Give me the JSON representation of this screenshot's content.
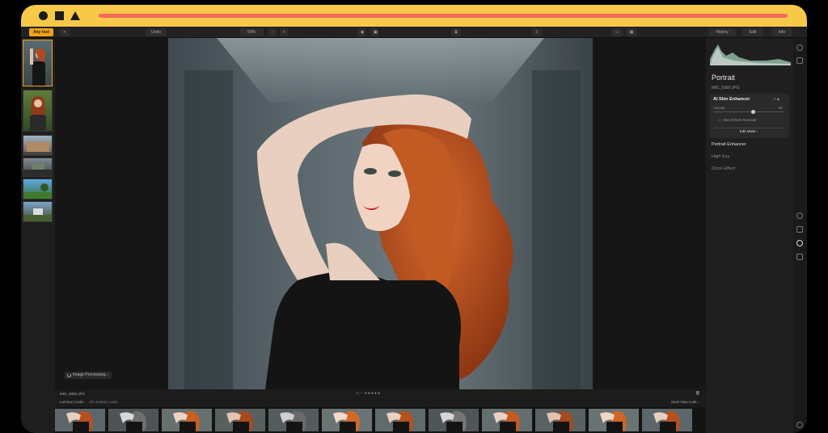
{
  "toolbar": {
    "active_button": "Any tool",
    "undo_label": "Undo",
    "zoom_label": "50%",
    "minus_label": "–",
    "plus_label": "+",
    "history_label": "History",
    "edit_label": "Edit",
    "info_label": "Info"
  },
  "right_panel": {
    "title": "Portrait",
    "filename": "IMG_5990.JPG",
    "card_title": "AI Skin Enhancer",
    "amount_label": "Amount",
    "amount_value": "50",
    "defects_label": "Skin Defects Removal",
    "edit_mask_label": "Edit Mask ›",
    "items": [
      "Portrait Enhancer",
      "High Key",
      "Orton Effect"
    ]
  },
  "canvas": {
    "processing_label": "Image Processing..."
  },
  "bottom": {
    "filename": "IMG_5990.JPG",
    "looks_label": "Luminar Looks",
    "looks_dropdown": "All Luminar Looks",
    "save_label": "Save New Look..."
  },
  "colors": {
    "accent": "#f2a31a",
    "titlebar": "#f7c948",
    "titlebar_line": "#f26b5b"
  }
}
